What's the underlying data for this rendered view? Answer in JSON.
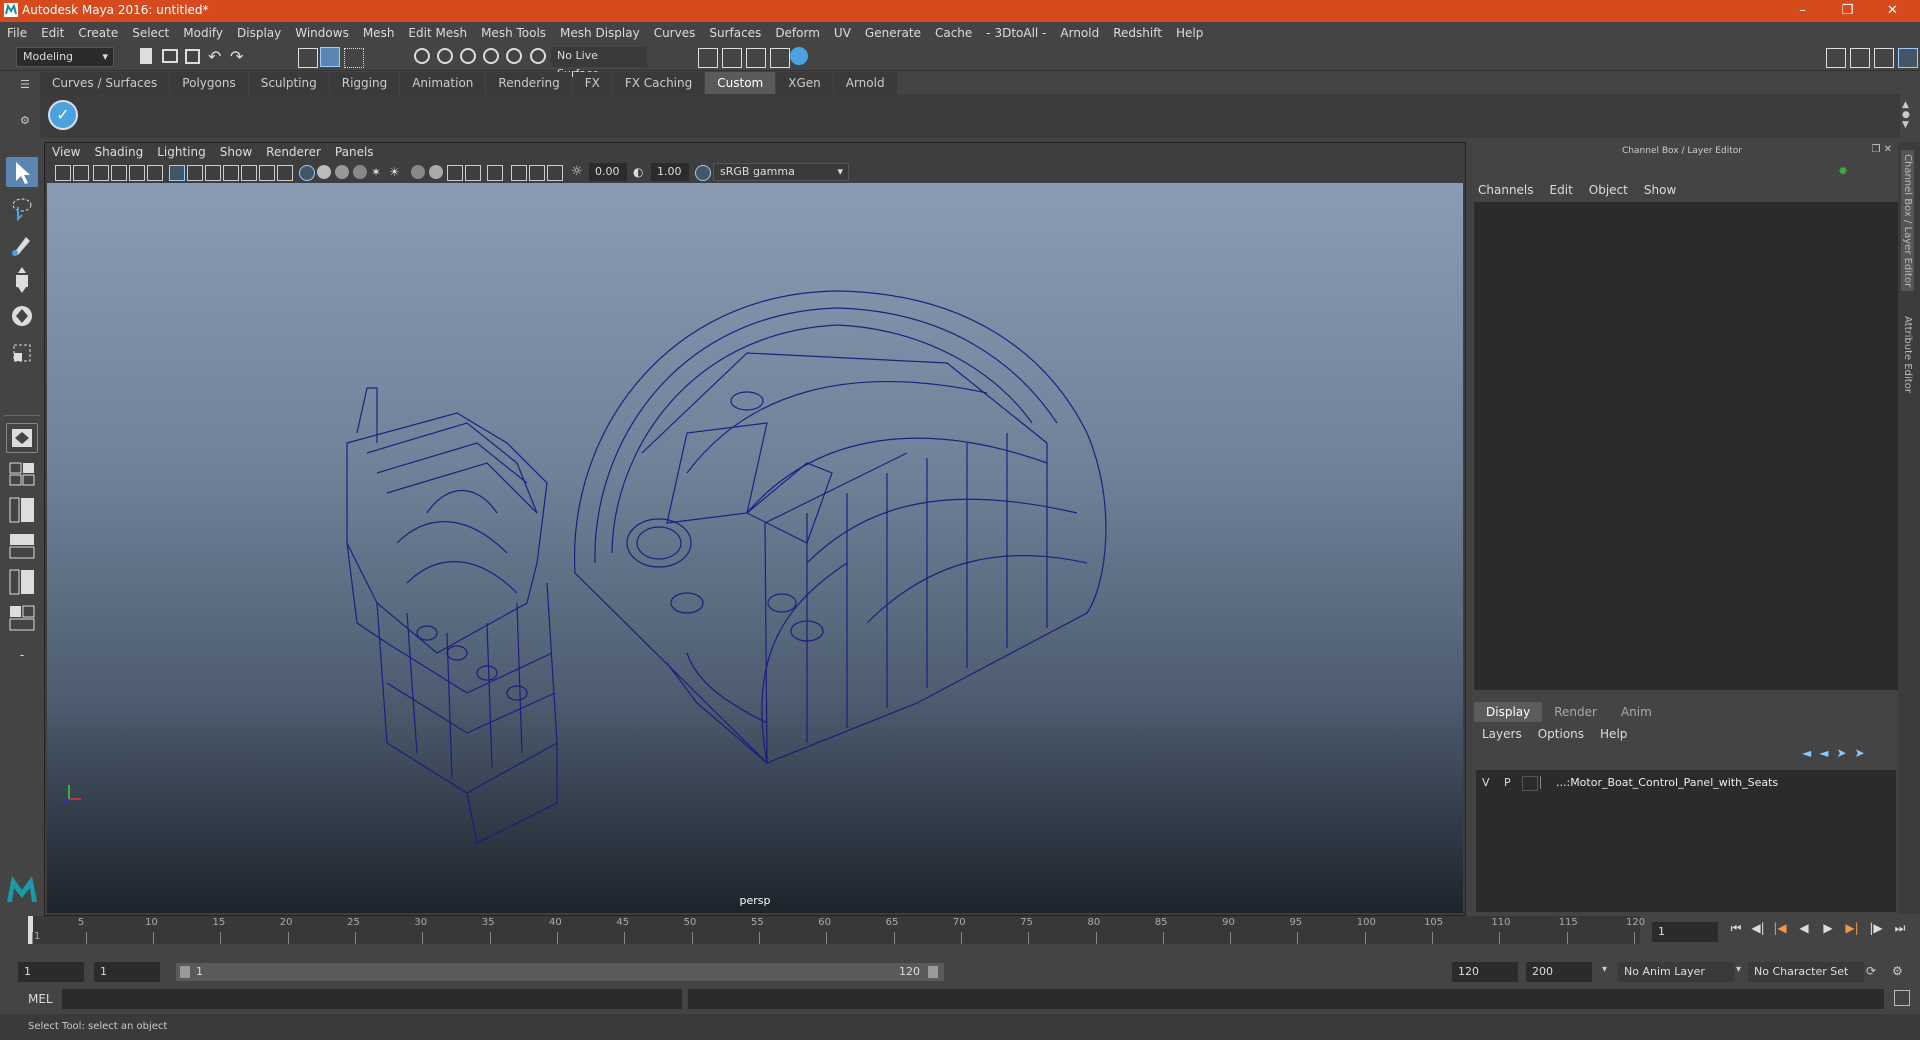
{
  "window": {
    "title": "Autodesk Maya 2016: untitled*"
  },
  "menubar": [
    "File",
    "Edit",
    "Create",
    "Select",
    "Modify",
    "Display",
    "Windows",
    "Mesh",
    "Edit Mesh",
    "Mesh Tools",
    "Mesh Display",
    "Curves",
    "Surfaces",
    "Deform",
    "UV",
    "Generate",
    "Cache",
    "- 3DtoAll -",
    "Arnold",
    "Redshift",
    "Help"
  ],
  "statusline": {
    "mode": "Modeling",
    "live_surface": "No Live Surface"
  },
  "shelf": {
    "tabs": [
      "Curves / Surfaces",
      "Polygons",
      "Sculpting",
      "Rigging",
      "Animation",
      "Rendering",
      "FX",
      "FX Caching",
      "Custom",
      "XGen",
      "Arnold"
    ],
    "active": "Custom"
  },
  "viewport": {
    "menu": [
      "View",
      "Shading",
      "Lighting",
      "Show",
      "Renderer",
      "Panels"
    ],
    "exposure": "0.00",
    "gamma": "1.00",
    "color_space": "sRGB gamma",
    "camera": "persp"
  },
  "channelbox": {
    "title": "Channel Box / Layer Editor",
    "menu": [
      "Channels",
      "Edit",
      "Object",
      "Show"
    ],
    "side_tabs": [
      "Channel Box / Layer Editor",
      "Attribute Editor"
    ]
  },
  "layer_editor": {
    "tabs": [
      "Display",
      "Render",
      "Anim"
    ],
    "active_tab": "Display",
    "menu": [
      "Layers",
      "Options",
      "Help"
    ],
    "layers": [
      {
        "v": "V",
        "p": "P",
        "name": "...:Motor_Boat_Control_Panel_with_Seats"
      }
    ]
  },
  "timeline": {
    "ticks": [
      "1",
      "5",
      "10",
      "15",
      "20",
      "25",
      "30",
      "35",
      "40",
      "45",
      "50",
      "55",
      "60",
      "65",
      "70",
      "75",
      "80",
      "85",
      "90",
      "95",
      "100",
      "105",
      "110",
      "115",
      "120"
    ],
    "current_frame": "1"
  },
  "range": {
    "start": "1",
    "current": "1",
    "slider_start": "1",
    "slider_end": "120",
    "end": "120",
    "max": "200",
    "anim_layer": "No Anim Layer",
    "character_set": "No Character Set"
  },
  "command": {
    "label": "MEL"
  },
  "help": {
    "text": "Select Tool: select an object"
  },
  "colors": {
    "titlebar": "#d64a1e",
    "wireframe": "#1a1a80",
    "accent": "#4aa3df"
  }
}
